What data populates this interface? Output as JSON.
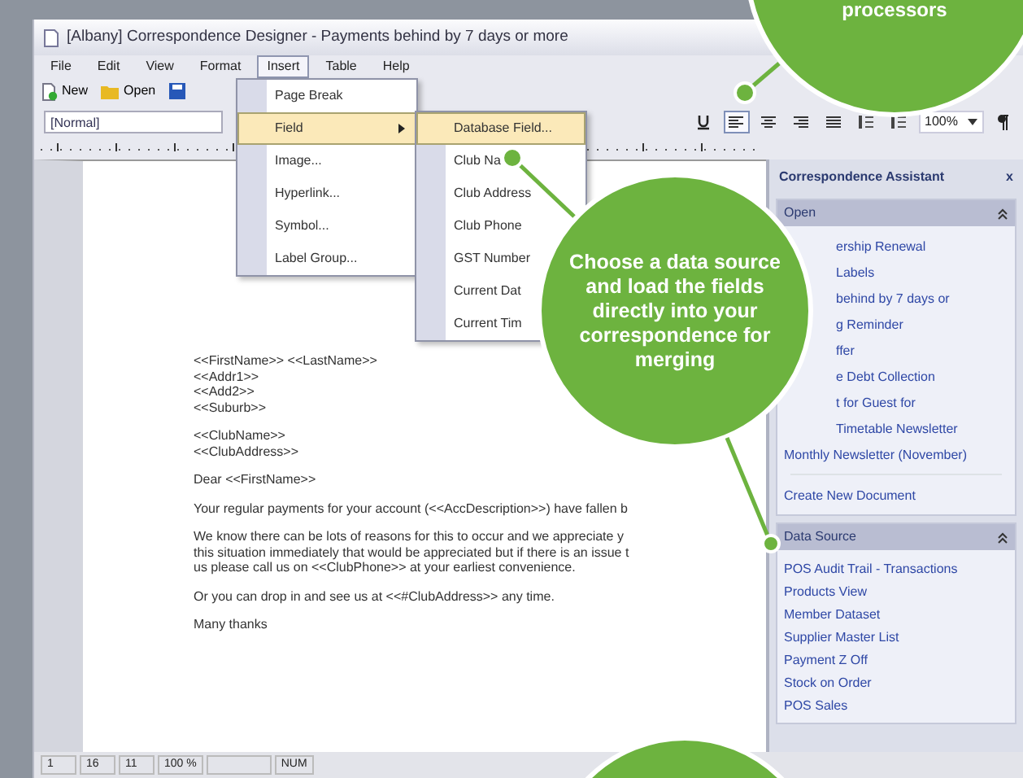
{
  "window": {
    "title": "[Albany] Correspondence Designer - Payments behind by 7 days or more"
  },
  "menu_bar": [
    {
      "label": "File",
      "selected": false
    },
    {
      "label": "Edit",
      "selected": false
    },
    {
      "label": "View",
      "selected": false
    },
    {
      "label": "Format",
      "selected": false
    },
    {
      "label": "Insert",
      "selected": true
    },
    {
      "label": "Table",
      "selected": false
    },
    {
      "label": "Help",
      "selected": false
    }
  ],
  "toolbar": [
    {
      "kind": "new",
      "label": "New"
    },
    {
      "kind": "open",
      "label": "Open"
    },
    {
      "kind": "save"
    }
  ],
  "format_bar": {
    "style": "[Normal]",
    "buttons": [
      {
        "kind": "underline",
        "selected": false
      },
      {
        "kind": "align-left",
        "selected": true
      },
      {
        "kind": "align-center",
        "selected": false
      },
      {
        "kind": "align-right",
        "selected": false
      },
      {
        "kind": "justify",
        "selected": false
      },
      {
        "kind": "list",
        "selected": false
      },
      {
        "kind": "list",
        "selected": false
      }
    ],
    "zoom": "100%"
  },
  "insert_menu": [
    {
      "label": "Page Break",
      "selected": false,
      "submenu": false
    },
    {
      "label": "Field",
      "selected": true,
      "submenu": true
    },
    {
      "label": "Image...",
      "selected": false,
      "submenu": false
    },
    {
      "label": "Hyperlink...",
      "selected": false,
      "submenu": false
    },
    {
      "label": "Symbol...",
      "selected": false,
      "submenu": false
    },
    {
      "label": "Label Group...",
      "selected": false,
      "submenu": false
    }
  ],
  "field_submenu": [
    {
      "label": "Database Field...",
      "selected": true
    },
    {
      "label": "Club Na",
      "selected": false
    },
    {
      "label": "Club Address",
      "selected": false
    },
    {
      "label": "Club Phone",
      "selected": false
    },
    {
      "label": "GST Number",
      "selected": false
    },
    {
      "label": "Current Dat",
      "selected": false
    },
    {
      "label": "Current Tim",
      "selected": false
    }
  ],
  "document": {
    "paragraphs": [
      [
        "<<FirstName>> <<LastName>>",
        "<<Addr1>>",
        "<<Add2>>",
        "<<Suburb>>"
      ],
      [
        "<<ClubName>>",
        "<<ClubAddress>>"
      ],
      [
        "Dear <<FirstName>>"
      ],
      [
        "Your regular payments for your account (<<AccDescription>>) have fallen b"
      ],
      [
        "We know there can be lots of reasons for this to occur and we appreciate y",
        "this situation immediately that would be appreciated but if there is an issue t",
        "us please call us on <<ClubPhone>> at your earliest convenience."
      ],
      [
        "Or you can drop in and see us at <<#ClubAddress>> any time."
      ],
      [
        "Many thanks"
      ]
    ]
  },
  "assistant": {
    "title": "Correspondence Assistant",
    "close": "x",
    "sections": [
      {
        "title": "Open",
        "items": [
          {
            "label": "ership Renewal",
            "partial": true
          },
          {
            "label": "Labels",
            "partial": true
          },
          {
            "label": "behind by 7 days or",
            "partial": true
          },
          {
            "label": "g Reminder",
            "partial": true
          },
          {
            "label": "ffer",
            "partial": true
          },
          {
            "label": "e Debt Collection",
            "partial": true
          },
          {
            "label": "t for Guest for",
            "partial": true
          },
          {
            "label": "Timetable Newsletter",
            "partial": true
          },
          {
            "label": "Monthly Newsletter (November)",
            "partial": false
          }
        ],
        "action": "Create New Document"
      },
      {
        "title": "Data Source",
        "items": [
          {
            "label": "POS Audit Trail - Transactions",
            "partial": false
          },
          {
            "label": "Products View",
            "partial": false
          },
          {
            "label": "Member Dataset",
            "partial": false
          },
          {
            "label": "Supplier Master List",
            "partial": false
          },
          {
            "label": "Payment Z Off",
            "partial": false
          },
          {
            "label": "Stock on Order",
            "partial": false
          },
          {
            "label": "POS Sales",
            "partial": false
          }
        ]
      }
    ]
  },
  "status_bar": [
    {
      "text": "1"
    },
    {
      "text": "16"
    },
    {
      "text": "11"
    },
    {
      "text": "100 %"
    },
    {
      "kind": "blank"
    },
    {
      "text": "NUM"
    }
  ],
  "callouts": [
    {
      "kind": "top",
      "text": "processors"
    },
    {
      "kind": "main",
      "text": "Choose a data source and load the fields directly into your correspondence for merging"
    },
    {
      "kind": "bottom"
    }
  ]
}
